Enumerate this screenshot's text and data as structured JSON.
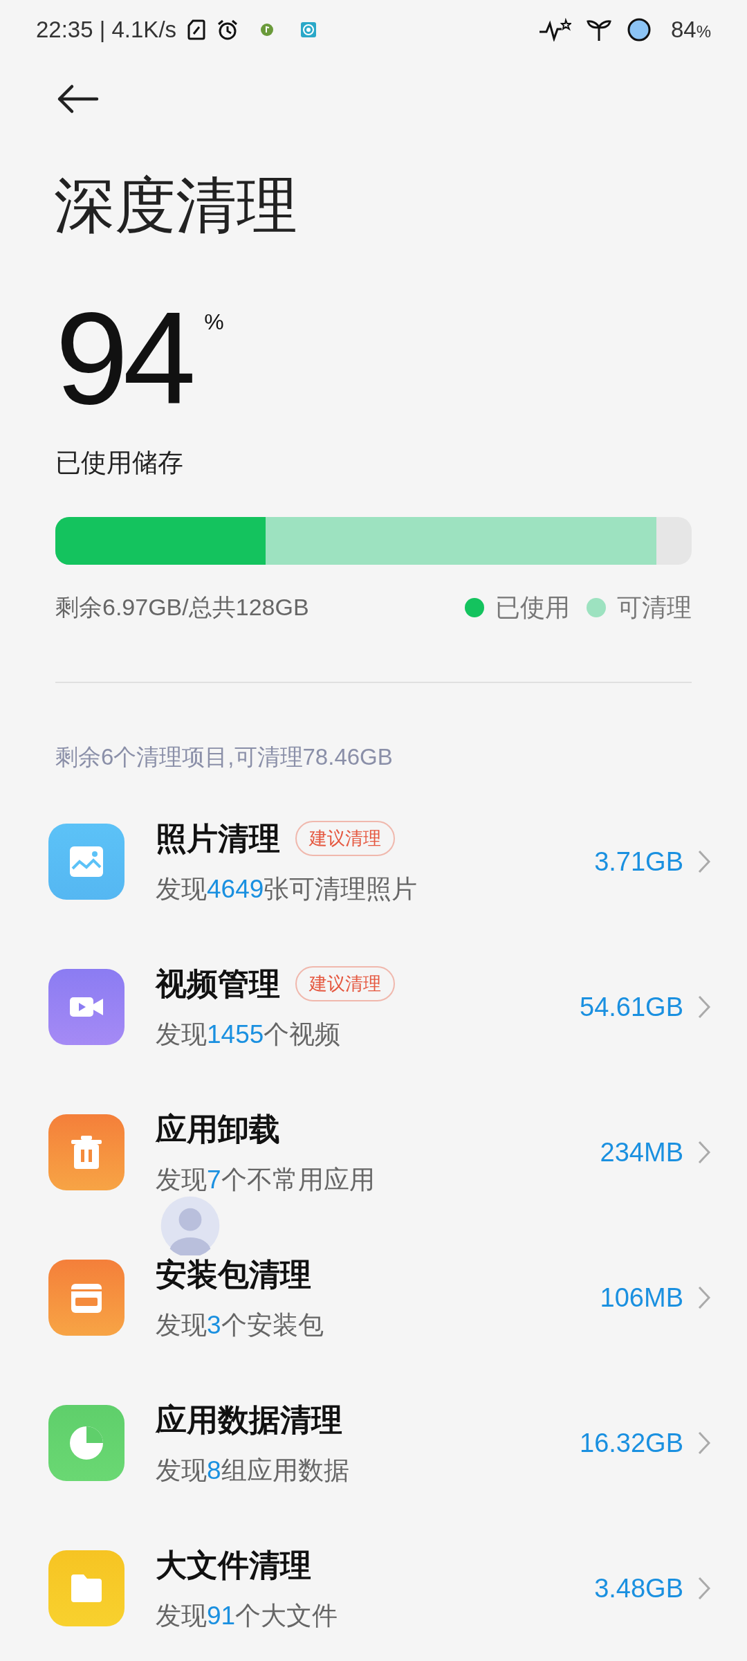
{
  "status_bar": {
    "time": "22:35 | 4.1K/s",
    "battery": {
      "value": "84",
      "unit": "%"
    }
  },
  "title": "深度清理",
  "storage": {
    "percent": "94",
    "unit": "%",
    "label": "已使用储存",
    "used": {
      "level": 0.33
    },
    "cleanable": {
      "level": 0.945
    },
    "remaining": "剩余6.97GB/总共128GB",
    "legend": [
      {
        "label": "已使用",
        "color": "#14c35e"
      },
      {
        "label": "可清理",
        "color": "#9de2c0"
      }
    ]
  },
  "summary": "剩余6个清理项目,可清理78.46GB",
  "items": [
    {
      "kind": "photo",
      "title": "照片清理",
      "badge": "建议清理",
      "prefix": "发现",
      "count": "4649",
      "suffix": "张可清理照片",
      "size": "3.71GB"
    },
    {
      "kind": "video",
      "title": "视频管理",
      "badge": "建议清理",
      "prefix": "发现",
      "count": "1455",
      "suffix": "个视频",
      "size": "54.61GB"
    },
    {
      "kind": "uninstall",
      "title": "应用卸载",
      "prefix": "发现",
      "count": "7",
      "suffix": "个不常用应用",
      "size": "234MB"
    },
    {
      "kind": "apk",
      "title": "安装包清理",
      "prefix": "发现",
      "count": "3",
      "suffix": "个安装包",
      "size": "106MB"
    },
    {
      "kind": "data",
      "title": "应用数据清理",
      "prefix": "发现",
      "count": "8",
      "suffix": "组应用数据",
      "size": "16.32GB"
    },
    {
      "kind": "large_file",
      "title": "大文件清理",
      "prefix": "发现",
      "count": "91",
      "suffix": "个大文件",
      "size": "3.48GB"
    }
  ]
}
